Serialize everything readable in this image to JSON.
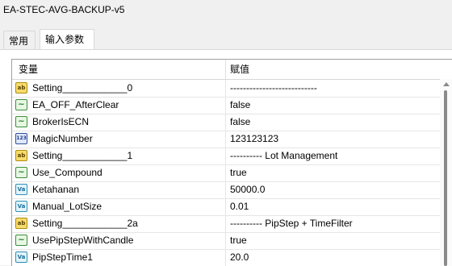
{
  "window": {
    "title": "EA-STEC-AVG-BACKUP-v5"
  },
  "tabs": [
    {
      "label": "常用"
    },
    {
      "label": "输入参数"
    }
  ],
  "grid": {
    "columns": {
      "variable": "变量",
      "value": "赋值"
    },
    "rows": [
      {
        "icon": "ab",
        "icon_text": "ab",
        "name": "Setting____________0",
        "value": "---------------------------"
      },
      {
        "icon": "bool",
        "icon_text": "~",
        "name": "EA_OFF_AfterClear",
        "value": "false"
      },
      {
        "icon": "bool",
        "icon_text": "~",
        "name": "BrokerIsECN",
        "value": "false"
      },
      {
        "icon": "num",
        "icon_text": "123",
        "name": "MagicNumber",
        "value": "123123123"
      },
      {
        "icon": "ab",
        "icon_text": "ab",
        "name": "Setting____________1",
        "value": "---------- Lot Management"
      },
      {
        "icon": "bool",
        "icon_text": "~",
        "name": "Use_Compound",
        "value": "true"
      },
      {
        "icon": "dbl",
        "icon_text": "Va",
        "name": "Ketahanan",
        "value": "50000.0"
      },
      {
        "icon": "dbl",
        "icon_text": "Va",
        "name": "Manual_LotSize",
        "value": "0.01"
      },
      {
        "icon": "ab",
        "icon_text": "ab",
        "name": "Setting____________2a",
        "value": "---------- PipStep + TimeFilter"
      },
      {
        "icon": "bool",
        "icon_text": "~",
        "name": "UsePipStepWithCandle",
        "value": "true"
      },
      {
        "icon": "dbl",
        "icon_text": "Va",
        "name": "PipStepTime1",
        "value": "20.0"
      }
    ]
  }
}
